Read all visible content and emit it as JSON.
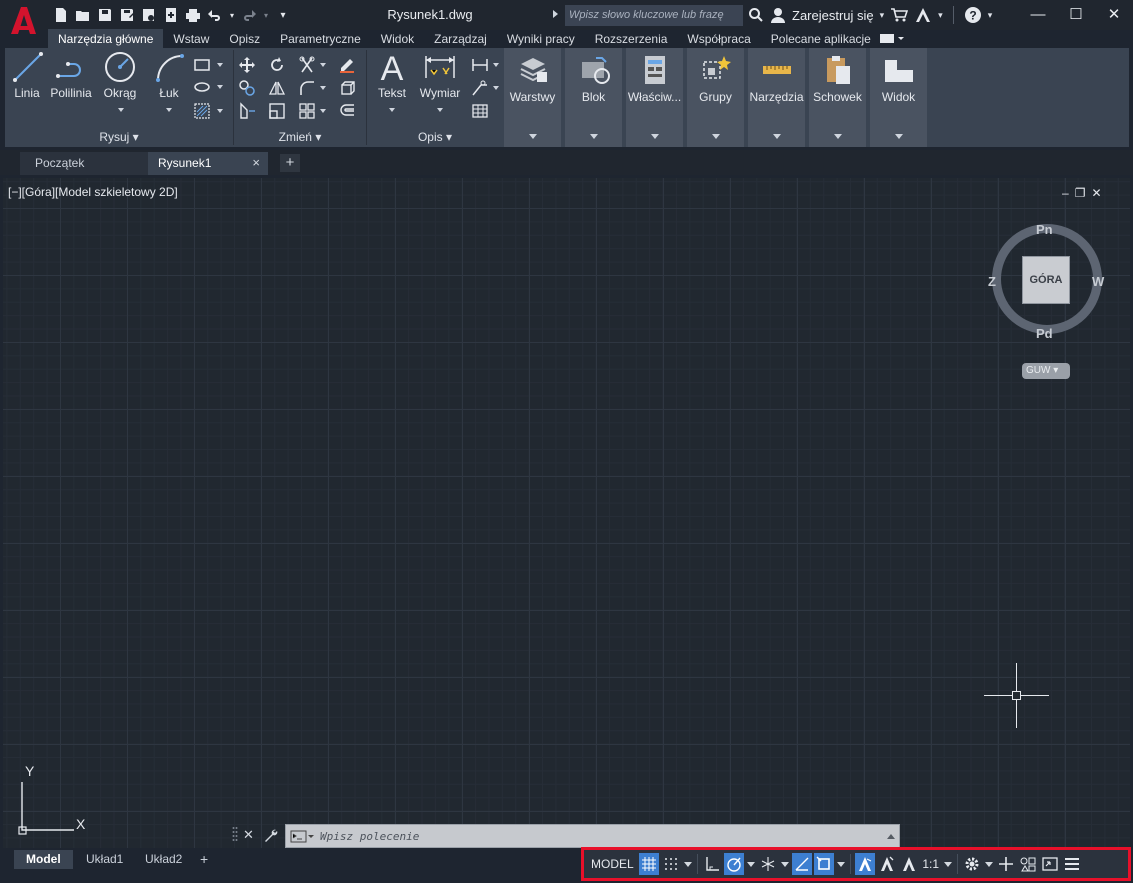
{
  "window": {
    "title": "Rysunek1.dwg",
    "search_placeholder": "Wpisz słowo kluczowe lub frazę",
    "signin_label": "Zarejestruj się",
    "help_label": "?"
  },
  "ribbon_tabs": [
    "Narzędzia główne",
    "Wstaw",
    "Opisz",
    "Parametryczne",
    "Widok",
    "Zarządzaj",
    "Wyniki pracy",
    "Rozszerzenia",
    "Współpraca",
    "Polecane aplikacje"
  ],
  "ribbon": {
    "draw": {
      "title": "Rysuj",
      "line": "Linia",
      "polyline": "Polilinia",
      "circle": "Okrąg",
      "arc": "Łuk"
    },
    "modify": {
      "title": "Zmień"
    },
    "annotation": {
      "title": "Opis",
      "text": "Tekst",
      "dimension": "Wymiar"
    },
    "layers": "Warstwy",
    "block": "Blok",
    "properties": "Właściw...",
    "groups": "Grupy",
    "utilities": "Narzędzia",
    "clipboard": "Schowek",
    "view": "Widok"
  },
  "doc_tabs": {
    "start": "Początek",
    "active": "Rysunek1",
    "close": "×",
    "new": "+"
  },
  "viewport": {
    "label": "[−][Góra][Model szkieletowy 2D]",
    "controls": [
      "‒",
      "❐",
      "✕"
    ]
  },
  "viewcube": {
    "face": "GÓRA",
    "north": "Pn",
    "south": "Pd",
    "west": "W",
    "east": "Z",
    "wcs": "GUW"
  },
  "ucs": {
    "y": "Y",
    "x": "X"
  },
  "command": {
    "placeholder": "Wpisz polecenie"
  },
  "layout_tabs": [
    "Model",
    "Układ1",
    "Układ2"
  ],
  "layout_add": "+",
  "statusbar": {
    "model": "MODEL",
    "scale": "1:1"
  },
  "colors": {
    "accent": "#3d7fd1",
    "highlight_border": "#e8102a",
    "logo_red": "#c8102e"
  }
}
